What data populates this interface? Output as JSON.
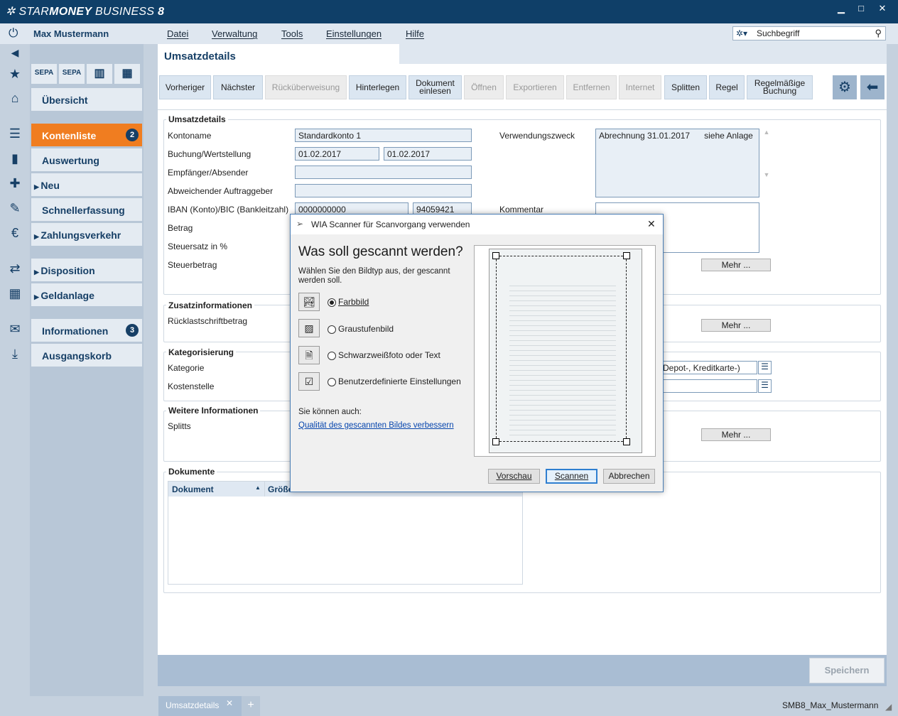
{
  "app": {
    "title_light": "STAR",
    "title_bold": "MONEY",
    "title_rest": " BUSINESS ",
    "title_ver": "8",
    "min": "▁",
    "max": "□",
    "close": "✕"
  },
  "menubar": {
    "user": "Max Mustermann",
    "items": [
      "Datei",
      "Verwaltung",
      "Tools",
      "Einstellungen",
      "Hilfe"
    ],
    "search_placeholder": "Suchbegriff"
  },
  "sidebar": {
    "quick": [
      "SEPA",
      "SEPA",
      "",
      ""
    ],
    "items": [
      {
        "label": "Übersicht"
      },
      {
        "label": "Kontenliste",
        "badge": "2"
      },
      {
        "label": "Auswertung"
      },
      {
        "label": "Neu"
      },
      {
        "label": "Schnellerfassung"
      },
      {
        "label": "Zahlungsverkehr"
      },
      {
        "label": "Disposition"
      },
      {
        "label": "Geldanlage"
      },
      {
        "label": "Informationen",
        "badge": "3"
      },
      {
        "label": "Ausgangskorb"
      }
    ]
  },
  "page": {
    "title": "Umsatzdetails"
  },
  "toolbar": [
    "Vorheriger",
    "Nächster",
    "Rücküberweisung",
    "Hinterlegen",
    "Dokument einlesen",
    "Öffnen",
    "Exportieren",
    "Entfernen",
    "Internet",
    "Splitten",
    "Regel",
    "Regelmäßige Buchung"
  ],
  "umsatz": {
    "title": "Umsatzdetails",
    "kontoname_label": "Kontoname",
    "kontoname": "Standardkonto 1",
    "buchung_label": "Buchung/Wertstellung",
    "buchung": "01.02.2017",
    "wertstellung": "01.02.2017",
    "empf_label": "Empfänger/Absender",
    "abw_label": "Abweichender Auftraggeber",
    "iban_label": "IBAN (Konto)/BIC (Bankleitzahl)",
    "iban": "0000000000",
    "bic": "94059421",
    "betrag_label": "Betrag",
    "steuersatz_label": "Steuersatz in %",
    "steuerbetrag_label": "Steuerbetrag",
    "vzweck_label": "Verwendungszweck",
    "vzweck": "Abrechnung 31.01.2017      siehe Anlage",
    "kommentar_label": "Kommentar",
    "mehr": "Mehr ..."
  },
  "zusatz": {
    "title": "Zusatzinformationen",
    "ruecklast_label": "Rücklastschriftbetrag",
    "mehr": "Mehr ..."
  },
  "kategorie": {
    "title": "Kategorisierung",
    "kategorie_label": "Kategorie",
    "kostenstelle_label": "Kostenstelle",
    "kategorie_value": "Depot-, Kreditkarte-)"
  },
  "weitere": {
    "title": "Weitere Informationen",
    "splitts_label": "Splitts",
    "mehr": "Mehr ..."
  },
  "dokumente": {
    "title": "Dokumente",
    "col1": "Dokument",
    "col2": "Größe"
  },
  "save": "Speichern",
  "tabs": {
    "active": "Umsatzdetails",
    "close": "✕",
    "add": "+",
    "profile": "SMB8_Max_Mustermann"
  },
  "dialog": {
    "title": "WIA Scanner für Scanvorgang verwenden",
    "heading": "Was soll gescannt werden?",
    "desc": "Wählen Sie den Bildtyp aus, der gescannt werden soll.",
    "options": [
      "Farbbild",
      "Graustufenbild",
      "Schwarzweißfoto oder Text",
      "Benutzerdefinierte Einstellungen"
    ],
    "also": "Sie können auch:",
    "link": "Qualität des gescannten Bildes verbessern",
    "preview": "Vorschau",
    "scan": "Scannen",
    "cancel": "Abbrechen"
  }
}
